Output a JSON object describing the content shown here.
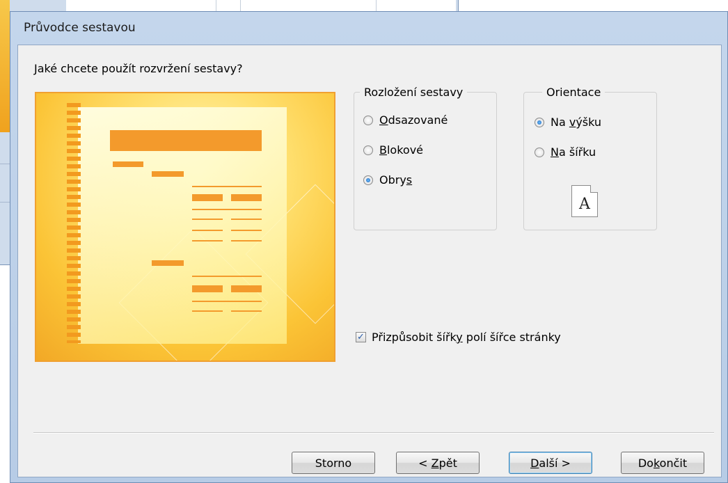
{
  "window": {
    "title": "Průvodce sestavou"
  },
  "question": "Jaké chcete použít rozvržení sestavy?",
  "layout_group": {
    "legend": "Rozložení sestavy",
    "options": [
      {
        "label": "Odsazované",
        "mnemonic": "O",
        "selected": false
      },
      {
        "label": "Blokové",
        "mnemonic": "B",
        "selected": false
      },
      {
        "label": "Obrys",
        "mnemonic": "s",
        "selected": true
      }
    ]
  },
  "orientation_group": {
    "legend": "Orientace",
    "options": [
      {
        "label": "Na výšku",
        "selected": true
      },
      {
        "label": "Na šířku",
        "selected": false
      }
    ],
    "icon_letter": "A"
  },
  "fit_checkbox": {
    "label": "Přizpůsobit šířky polí šířce stránky",
    "checked": true
  },
  "buttons": {
    "cancel": "Storno",
    "back": "< Zpět",
    "next": "Další >",
    "finish": "Dokončit"
  },
  "colors": {
    "accent": "#f39a2c",
    "preview_border": "#f0a030",
    "dialog_frame": "#b7cce6"
  }
}
